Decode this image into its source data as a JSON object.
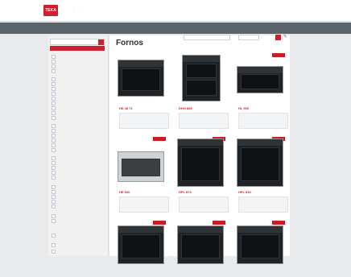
{
  "header": {
    "logo_text": "TEKA",
    "util_links": [
      " ",
      " ",
      " "
    ],
    "right_text": " "
  },
  "nav": {
    "items": [
      " ",
      " ",
      " ",
      " "
    ],
    "right": " "
  },
  "sidebar": {
    "search_placeholder": "",
    "selected_tab": " ",
    "facets": [
      "",
      "",
      "",
      "",
      "",
      "",
      "",
      "",
      "",
      "",
      "",
      "",
      "",
      "",
      "",
      "",
      "",
      "",
      "",
      "",
      "",
      "",
      "",
      "",
      "",
      "",
      "",
      "",
      "",
      "",
      "",
      "",
      "",
      ""
    ]
  },
  "main": {
    "title": "Fornos",
    "sort_label": "",
    "sort_value": "",
    "sort_value_2": ""
  },
  "products": [
    {
      "model": "HS 45 71",
      "line1": "",
      "line2": ""
    },
    {
      "model": "DHG 885",
      "line1": "",
      "line2": ""
    },
    {
      "model": "HL 960",
      "line1": "",
      "line2": ""
    },
    {
      "model": "HE 600",
      "line1": "",
      "line2": ""
    },
    {
      "model": "HPL 870",
      "line1": "",
      "line2": ""
    },
    {
      "model": "HPL 830",
      "line1": "",
      "line2": ""
    }
  ],
  "colors": {
    "accent": "#d01f2f",
    "nav_bg": "#5b636b",
    "page_bg": "#e9eaec"
  }
}
